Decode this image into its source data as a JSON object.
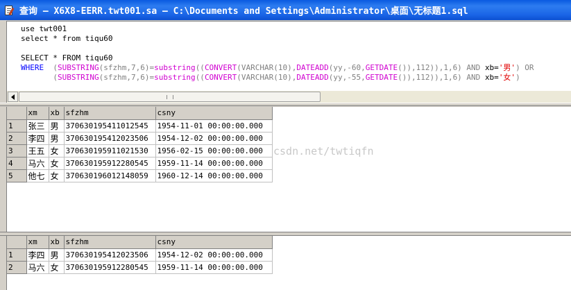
{
  "window": {
    "title": "查询 — X6X8-EERR.twt001.sa — C:\\Documents and Settings\\Administrator\\桌面\\无标题1.sql"
  },
  "editor": {
    "lines": [
      [
        {
          "t": "use twt001",
          "c": ""
        }
      ],
      [
        {
          "t": "select * from tiqu60",
          "c": ""
        }
      ],
      [
        {
          "t": "",
          "c": ""
        }
      ],
      [
        {
          "t": "SELECT * FROM tiqu60",
          "c": ""
        }
      ],
      [
        {
          "t": "WHERE  ",
          "c": "kw"
        },
        {
          "t": "(",
          "c": "op"
        },
        {
          "t": "SUBSTRING",
          "c": "fn"
        },
        {
          "t": "(sfzhm,7,6)=",
          "c": "op"
        },
        {
          "t": "substring",
          "c": "fn"
        },
        {
          "t": "((",
          "c": "op"
        },
        {
          "t": "CONVERT",
          "c": "fn"
        },
        {
          "t": "(VARCHAR(10),",
          "c": "op"
        },
        {
          "t": "DATEADD",
          "c": "fn"
        },
        {
          "t": "(yy,-60,",
          "c": "op"
        },
        {
          "t": "GETDATE",
          "c": "fn"
        },
        {
          "t": "()),112)),1,6)",
          "c": "op"
        },
        {
          "t": " AND ",
          "c": "op"
        },
        {
          "t": "xb=",
          "c": ""
        },
        {
          "t": "'男'",
          "c": "str"
        },
        {
          "t": ")",
          "c": "op"
        },
        {
          "t": " OR",
          "c": "op"
        }
      ],
      [
        {
          "t": "       ",
          "c": ""
        },
        {
          "t": "(",
          "c": "op"
        },
        {
          "t": "SUBSTRING",
          "c": "fn"
        },
        {
          "t": "(sfzhm,7,6)=",
          "c": "op"
        },
        {
          "t": "substring",
          "c": "fn"
        },
        {
          "t": "((",
          "c": "op"
        },
        {
          "t": "CONVERT",
          "c": "fn"
        },
        {
          "t": "(VARCHAR(10),",
          "c": "op"
        },
        {
          "t": "DATEADD",
          "c": "fn"
        },
        {
          "t": "(yy,-55,",
          "c": "op"
        },
        {
          "t": "GETDATE",
          "c": "fn"
        },
        {
          "t": "()),112)),1,6)",
          "c": "op"
        },
        {
          "t": " AND ",
          "c": "op"
        },
        {
          "t": "xb=",
          "c": ""
        },
        {
          "t": "'女'",
          "c": "str"
        },
        {
          "t": ")",
          "c": "op"
        }
      ]
    ]
  },
  "grid1": {
    "columns": [
      "xm",
      "xb",
      "sfzhm",
      "csny"
    ],
    "rows": [
      {
        "n": "1",
        "xm": "张三",
        "xb": "男",
        "sfzhm": "370630195411012545",
        "csny": "1954-11-01 00:00:00.000"
      },
      {
        "n": "2",
        "xm": "李四",
        "xb": "男",
        "sfzhm": "370630195412023506",
        "csny": "1954-12-02 00:00:00.000"
      },
      {
        "n": "3",
        "xm": "王五",
        "xb": "女",
        "sfzhm": "370630195911021530",
        "csny": "1956-02-15 00:00:00.000"
      },
      {
        "n": "4",
        "xm": "马六",
        "xb": "女",
        "sfzhm": "370630195912280545",
        "csny": "1959-11-14 00:00:00.000"
      },
      {
        "n": "5",
        "xm": "他七",
        "xb": "女",
        "sfzhm": "370630196012148059",
        "csny": "1960-12-14 00:00:00.000"
      }
    ],
    "watermark": "csdn.net/twtiqfn"
  },
  "grid2": {
    "columns": [
      "xm",
      "xb",
      "sfzhm",
      "csny"
    ],
    "rows": [
      {
        "n": "1",
        "xm": "李四",
        "xb": "男",
        "sfzhm": "370630195412023506",
        "csny": "1954-12-02 00:00:00.000"
      },
      {
        "n": "2",
        "xm": "马六",
        "xb": "女",
        "sfzhm": "370630195912280545",
        "csny": "1959-11-14 00:00:00.000"
      }
    ]
  }
}
